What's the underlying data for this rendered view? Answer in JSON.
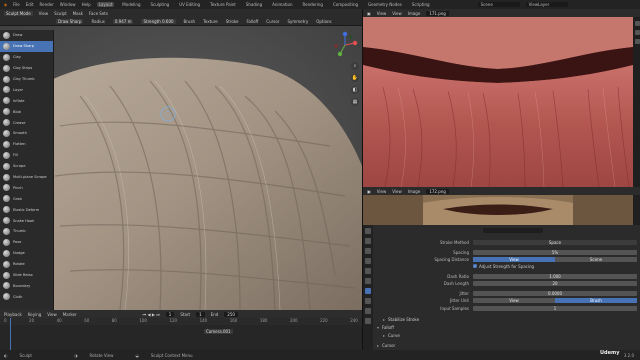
{
  "topbar": {
    "menus": [
      "File",
      "Edit",
      "Render",
      "Window",
      "Help"
    ],
    "workspaces": [
      "Layout",
      "Modeling",
      "Sculpting",
      "UV Editing",
      "Texture Paint",
      "Shading",
      "Animation",
      "Rendering",
      "Compositing",
      "Geometry Nodes",
      "Scripting"
    ],
    "active_workspace": "Layout",
    "scene_label": "Scene",
    "viewlayer_label": "ViewLayer"
  },
  "tool_header": {
    "mode": "Sculpt Mode",
    "menus": [
      "View",
      "Sculpt",
      "Mask",
      "Face Sets"
    ],
    "brush_name": "Draw Sharp",
    "radius_label": "Radius",
    "radius_value": "0.947 m",
    "strength_label": "Strength",
    "strength_value": "0.600",
    "brush_label": "Brush",
    "texture_label": "Texture",
    "stroke_label": "Stroke",
    "falloff_label": "Falloff",
    "cursor_label": "Cursor",
    "symmetry_label": "Symmetry",
    "options_label": "Options"
  },
  "brushes": [
    "Draw",
    "Draw Sharp",
    "Clay",
    "Clay Strips",
    "Clay Thumb",
    "Layer",
    "Inflate",
    "Blob",
    "Crease",
    "Smooth",
    "Flatten",
    "Fill",
    "Scrape",
    "Multi-plane Scrape",
    "Pinch",
    "Grab",
    "Elastic Deform",
    "Snake Hook",
    "Thumb",
    "Pose",
    "Nudge",
    "Rotate",
    "Slide Relax",
    "Boundary",
    "Cloth"
  ],
  "selected_brush_index": 1,
  "timeline": {
    "menus": [
      "Playback",
      "Keying",
      "View",
      "Marker"
    ],
    "current_frame": "1",
    "start_label": "Start",
    "start_value": "1",
    "end_label": "End",
    "end_value": "250",
    "ruler": [
      "0",
      "10",
      "20",
      "30",
      "40",
      "50",
      "60",
      "70",
      "80",
      "90",
      "100",
      "110",
      "120",
      "130",
      "140",
      "150",
      "160",
      "170",
      "180",
      "190",
      "200",
      "210",
      "220",
      "230",
      "240",
      "250"
    ],
    "camera_label": "Camera.001"
  },
  "image_editor_top": {
    "menus": [
      "View",
      "View",
      "Image"
    ],
    "image_name": "171.png"
  },
  "image_editor_bottom": {
    "menus": [
      "View",
      "View",
      "Image"
    ],
    "image_name": "172.png"
  },
  "properties": {
    "search_placeholder": "",
    "stroke_method_label": "Stroke Method",
    "stroke_method_value": "Space",
    "spacing_label": "Spacing",
    "spacing_value": "5%",
    "spacing_distance_label": "Spacing Distance",
    "spacing_distance_options": [
      "View",
      "Scene"
    ],
    "spacing_distance_selected": "View",
    "adjust_strength_label": "Adjust Strength for Spacing",
    "dash_ratio_label": "Dash Ratio",
    "dash_ratio_value": "1.000",
    "dash_length_label": "Dash Length",
    "dash_length_value": "20",
    "jitter_label": "Jitter",
    "jitter_value": "0.0000",
    "jitter_unit_label": "Jitter Unit",
    "jitter_unit_options": [
      "View",
      "Brush"
    ],
    "jitter_unit_selected": "Brush",
    "input_samples_label": "Input Samples",
    "input_samples_value": "1",
    "panels": [
      "Stabilize Stroke",
      "Falloff",
      "Curve",
      "Cursor"
    ]
  },
  "statusbar": {
    "items": [
      "Sculpt",
      "Rotate View",
      "Sculpt Context Menu"
    ],
    "version": "3.2.0"
  },
  "watermark": "Udemy",
  "colors": {
    "accent": "#4772b3",
    "panel": "#2b2b2b",
    "viewport_clay": "#a8998a"
  }
}
